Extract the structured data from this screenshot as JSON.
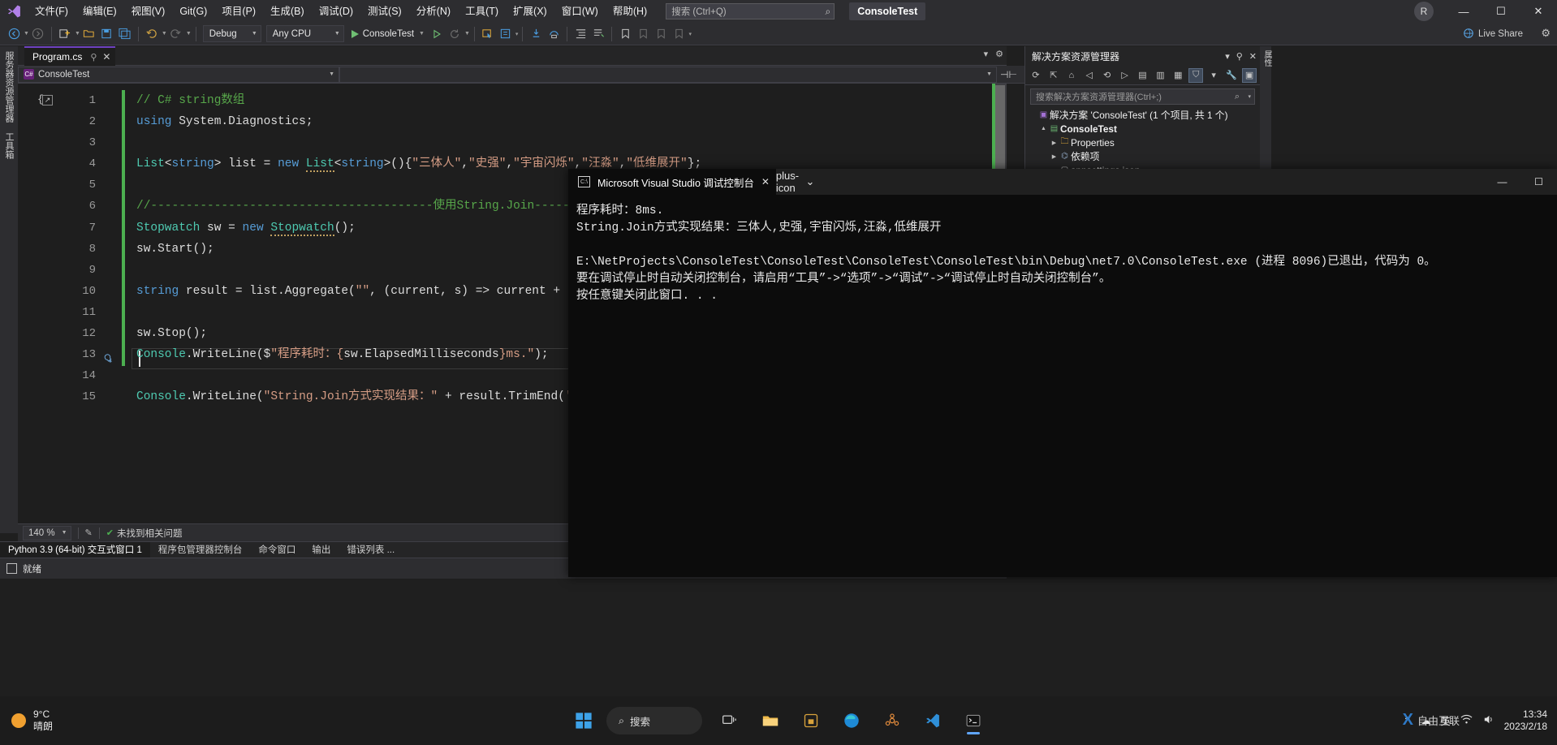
{
  "app": {
    "title": "ConsoleTest",
    "account_initial": "R"
  },
  "menubar": {
    "items": [
      {
        "label": "文件(F)"
      },
      {
        "label": "编辑(E)"
      },
      {
        "label": "视图(V)"
      },
      {
        "label": "Git(G)"
      },
      {
        "label": "项目(P)"
      },
      {
        "label": "生成(B)"
      },
      {
        "label": "调试(D)"
      },
      {
        "label": "测试(S)"
      },
      {
        "label": "分析(N)"
      },
      {
        "label": "工具(T)"
      },
      {
        "label": "扩展(X)"
      },
      {
        "label": "窗口(W)"
      },
      {
        "label": "帮助(H)"
      }
    ],
    "quick_launch_placeholder": "搜索 (Ctrl+Q)",
    "search_icon": "search-icon",
    "minimize": "—",
    "maximize": "☐",
    "close": "✕"
  },
  "toolbar": {
    "back_icon": "navigate-back-icon",
    "forward_icon": "navigate-forward-icon",
    "new_project_icon": "new-project-icon",
    "open_icon": "open-file-icon",
    "save_icon": "save-icon",
    "save_all_icon": "save-all-icon",
    "undo_icon": "undo-icon",
    "redo_icon": "redo-icon",
    "config_value": "Debug",
    "platform_value": "Any CPU",
    "run_label": "ConsoleTest",
    "run_icon": "play-icon",
    "start_without_debug_icon": "play-outline-icon",
    "hot_reload_icon": "hot-reload-icon",
    "live_share_label": "Live Share",
    "live_share_icon": "live-share-icon",
    "overflow_icon": "toolbar-overflow-icon"
  },
  "left_rail": {
    "tabs": [
      "服务器资源管理器",
      "工具箱"
    ]
  },
  "right_rail": {
    "tabs": [
      "属性"
    ]
  },
  "document_tabs": {
    "active": "Program.cs",
    "pin_icon": "pin-icon",
    "close_icon": "close-icon"
  },
  "navbar": {
    "project_value": "ConsoleTest",
    "member_value": "",
    "project_icon": "csharp-project-icon"
  },
  "editor": {
    "language": "csharp",
    "lines": [
      {
        "num": 1,
        "tokens": [
          {
            "t": "// C# string数组",
            "c": "c-comment"
          }
        ]
      },
      {
        "num": 2,
        "tokens": [
          {
            "t": "using",
            "c": "c-keyword"
          },
          {
            "t": " System.Diagnostics;",
            "c": "c-ident"
          }
        ]
      },
      {
        "num": 3,
        "tokens": []
      },
      {
        "num": 4,
        "tokens": [
          {
            "t": "List",
            "c": "c-type"
          },
          {
            "t": "<",
            "c": "c-punct"
          },
          {
            "t": "string",
            "c": "c-keyword"
          },
          {
            "t": "> list = ",
            "c": "c-punct"
          },
          {
            "t": "new",
            "c": "c-keyword"
          },
          {
            "t": " ",
            "c": "c-punct"
          },
          {
            "t": "List",
            "c": "c-type squiggle"
          },
          {
            "t": "<",
            "c": "c-punct"
          },
          {
            "t": "string",
            "c": "c-keyword"
          },
          {
            "t": ">(){",
            "c": "c-punct"
          },
          {
            "t": "\"三体人\"",
            "c": "c-string"
          },
          {
            "t": ",",
            "c": "c-punct"
          },
          {
            "t": "\"史强\"",
            "c": "c-string"
          },
          {
            "t": ",",
            "c": "c-punct"
          },
          {
            "t": "\"宇宙闪烁\"",
            "c": "c-string"
          },
          {
            "t": ",",
            "c": "c-punct"
          },
          {
            "t": "\"汪淼\"",
            "c": "c-string"
          },
          {
            "t": ",",
            "c": "c-punct"
          },
          {
            "t": "\"低维展开\"",
            "c": "c-string"
          },
          {
            "t": "};",
            "c": "c-punct"
          }
        ]
      },
      {
        "num": 5,
        "tokens": []
      },
      {
        "num": 6,
        "tokens": [
          {
            "t": "//----------------------------------------使用String.Join-------------------------------------",
            "c": "c-comment"
          }
        ]
      },
      {
        "num": 7,
        "tokens": [
          {
            "t": "Stopwatch",
            "c": "c-type"
          },
          {
            "t": " sw = ",
            "c": "c-punct"
          },
          {
            "t": "new",
            "c": "c-keyword"
          },
          {
            "t": " ",
            "c": "c-punct"
          },
          {
            "t": "Stopwatch",
            "c": "c-type squiggle"
          },
          {
            "t": "();",
            "c": "c-punct"
          }
        ]
      },
      {
        "num": 8,
        "tokens": [
          {
            "t": "sw.Start();",
            "c": "c-ident"
          }
        ]
      },
      {
        "num": 9,
        "tokens": []
      },
      {
        "num": 10,
        "tokens": [
          {
            "t": "string",
            "c": "c-keyword"
          },
          {
            "t": " result = list.Aggregate(",
            "c": "c-punct"
          },
          {
            "t": "\"\"",
            "c": "c-string"
          },
          {
            "t": ", (current, s) => current + (s + ",
            "c": "c-punct"
          },
          {
            "t": "\",\"",
            "c": "c-string"
          },
          {
            "t": "));",
            "c": "c-punct"
          }
        ]
      },
      {
        "num": 11,
        "tokens": []
      },
      {
        "num": 12,
        "tokens": [
          {
            "t": "sw.Stop();",
            "c": "c-ident"
          }
        ]
      },
      {
        "num": 13,
        "tokens": [
          {
            "t": "Console",
            "c": "c-type"
          },
          {
            "t": ".WriteLine($",
            "c": "c-punct"
          },
          {
            "t": "\"程序耗时：{",
            "c": "c-string"
          },
          {
            "t": "sw.ElapsedMilliseconds",
            "c": "c-punct"
          },
          {
            "t": "}ms.\"",
            "c": "c-string"
          },
          {
            "t": ");",
            "c": "c-punct"
          }
        ]
      },
      {
        "num": 14,
        "tokens": []
      },
      {
        "num": 15,
        "tokens": [
          {
            "t": "Console",
            "c": "c-type"
          },
          {
            "t": ".WriteLine(",
            "c": "c-punct"
          },
          {
            "t": "\"String.Join方式实现结果：\"",
            "c": "c-string"
          },
          {
            "t": " + result.TrimEnd(",
            "c": "c-punct"
          },
          {
            "t": "','",
            "c": "c-string"
          },
          {
            "t": "));",
            "c": "c-punct"
          }
        ]
      }
    ],
    "caret_line": 14,
    "quickactions_icon": "lightbulb-icon",
    "collapse_icon": "collapse-block-icon"
  },
  "editor_status": {
    "zoom": "140 %",
    "issues_icon": "no-issues-icon",
    "issues_text": "未找到相关问题",
    "selection_icon": "selection-icon",
    "pencil_icon": "edit-icon"
  },
  "bottom_tabs": {
    "items": [
      {
        "label": "Python 3.9 (64-bit) 交互式窗口 1",
        "active": true
      },
      {
        "label": "程序包管理器控制台",
        "active": false
      },
      {
        "label": "命令窗口",
        "active": false
      },
      {
        "label": "输出",
        "active": false
      },
      {
        "label": "错误列表 ...",
        "active": false
      }
    ]
  },
  "vs_status": {
    "text": "就绪"
  },
  "solution_explorer": {
    "title": "解决方案资源管理器",
    "search_placeholder": "搜索解决方案资源管理器(Ctrl+;)",
    "search_icon": "search-icon",
    "search_caret_icon": "chevron-down-icon",
    "toolbar_icons": [
      "refresh-icon",
      "home-icon",
      "collapse-all-icon",
      "sync-with-active-icon",
      "show-all-files-icon",
      "back-icon",
      "forward-icon",
      "properties-icon",
      "preview-selected-icon",
      "filter-icon",
      "wrench-icon",
      "solution-view-icon"
    ],
    "header_actions": [
      "chevron-down-icon",
      "pin-icon",
      "close-icon"
    ],
    "tree": [
      {
        "indent": 0,
        "twisty": "",
        "icon": "solution-icon",
        "label": "解决方案 'ConsoleTest' (1 个项目, 共 1 个)",
        "bold": false
      },
      {
        "indent": 1,
        "twisty": "▲",
        "icon": "csharp-project-icon",
        "label": "ConsoleTest",
        "bold": true
      },
      {
        "indent": 2,
        "twisty": "▶",
        "icon": "properties-folder-icon",
        "label": "Properties",
        "bold": false
      },
      {
        "indent": 2,
        "twisty": "▶",
        "icon": "dependencies-icon",
        "label": "依赖项",
        "bold": false
      },
      {
        "indent": 2,
        "twisty": "",
        "icon": "json-file-icon",
        "label": "appsettings.json",
        "bold": false
      }
    ]
  },
  "console_window": {
    "tab_title": "Microsoft Visual Studio 调试控制台",
    "tab_icon": "terminal-icon",
    "close_icon": "close-icon",
    "new_tab_icon": "plus-icon",
    "dropdown_icon": "chevron-down-icon",
    "minimize_icon": "minimize-icon",
    "maximize_icon": "maximize-icon",
    "output_lines": [
      "程序耗时：8ms.",
      "String.Join方式实现结果：三体人,史强,宇宙闪烁,汪淼,低维展开",
      "",
      "E:\\NetProjects\\ConsoleTest\\ConsoleTest\\ConsoleTest\\ConsoleTest\\bin\\Debug\\net7.0\\ConsoleTest.exe (进程 8096)已退出，代码为 0。",
      "要在调试停止时自动关闭控制台，请启用“工具”->“选项”->“调试”->“调试停止时自动关闭控制台”。",
      "按任意键关闭此窗口. . ."
    ]
  },
  "taskbar": {
    "weather_temp": "9°C",
    "weather_desc": "晴朗",
    "weather_icon": "sun-icon",
    "start_icon": "windows-start-icon",
    "search_label": "搜索",
    "search_icon": "search-icon",
    "pinned": [
      {
        "name": "task-view-icon",
        "glyph": "▭"
      },
      {
        "name": "file-explorer-icon",
        "glyph": "🗀"
      },
      {
        "name": "store-icon",
        "glyph": "▤"
      },
      {
        "name": "edge-browser-icon",
        "glyph": "◉"
      },
      {
        "name": "tools-icon",
        "glyph": "✿"
      },
      {
        "name": "vs-code-icon",
        "glyph": "◣"
      },
      {
        "name": "terminal-icon",
        "glyph": "▣"
      }
    ],
    "tray": {
      "overflow_icon": "show-hidden-icons-icon",
      "cloud_icon": "onedrive-icon",
      "ime_label": "英",
      "network_icon": "network-icon",
      "volume_icon": "volume-icon",
      "time": "13:34",
      "date": "2023/2/18"
    }
  },
  "watermark": {
    "brand": "自由互联",
    "x_glyph": "X"
  },
  "colors": {
    "accent_purple": "#6f42c1",
    "change_bar_green": "#4caf50",
    "comment_green": "#57a64a",
    "string_orange": "#d69d85",
    "keyword_blue": "#569cd6",
    "type_teal": "#4ec9b0",
    "console_bg": "#0c0c0c",
    "editor_bg": "#1e1e1e",
    "chrome_bg": "#2d2d30"
  }
}
